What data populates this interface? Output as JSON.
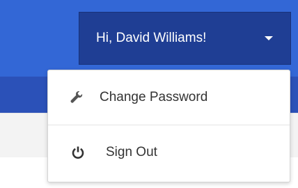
{
  "header": {
    "greeting": "Hi, David Williams!",
    "accent_color": "#3367d6",
    "button_color": "#1f3e94"
  },
  "user_menu": {
    "items": [
      {
        "label": "Change Password",
        "icon": "wrench-icon"
      },
      {
        "label": "Sign Out",
        "icon": "power-icon"
      }
    ]
  }
}
